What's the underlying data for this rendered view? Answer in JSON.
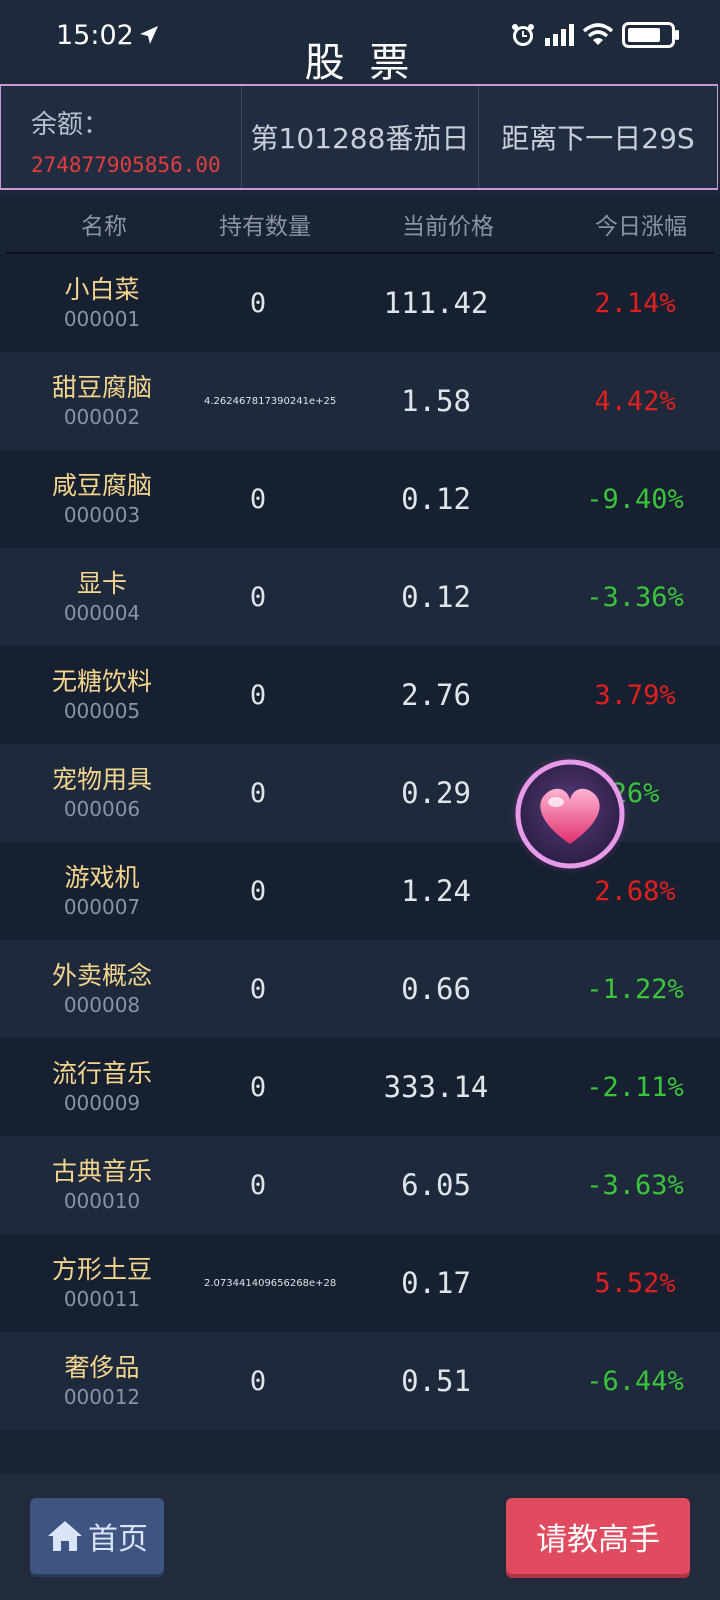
{
  "status_bar": {
    "time": "15:02"
  },
  "header": {
    "title": "股 票"
  },
  "info": {
    "balance_label": "余额：",
    "balance_value": "274877905856.00",
    "day_text": "第101288番茄日",
    "countdown_text": "距离下一日29S"
  },
  "table": {
    "headers": [
      "名称",
      "持有数量",
      "当前价格",
      "今日涨幅"
    ],
    "rows": [
      {
        "name": "小白菜",
        "code": "000001",
        "qty": "0",
        "price": "111.42",
        "change": "2.14%",
        "dir": "up"
      },
      {
        "name": "甜豆腐脑",
        "code": "000002",
        "qty": "4.262467817390241e+25",
        "price": "1.58",
        "change": "4.42%",
        "dir": "up"
      },
      {
        "name": "咸豆腐脑",
        "code": "000003",
        "qty": "0",
        "price": "0.12",
        "change": "-9.40%",
        "dir": "down"
      },
      {
        "name": "显卡",
        "code": "000004",
        "qty": "0",
        "price": "0.12",
        "change": "-3.36%",
        "dir": "down"
      },
      {
        "name": "无糖饮料",
        "code": "000005",
        "qty": "0",
        "price": "2.76",
        "change": "3.79%",
        "dir": "up"
      },
      {
        "name": "宠物用具",
        "code": "000006",
        "qty": "0",
        "price": "0.29",
        "change": "26%",
        "dir": "down"
      },
      {
        "name": "游戏机",
        "code": "000007",
        "qty": "0",
        "price": "1.24",
        "change": "2.68%",
        "dir": "up"
      },
      {
        "name": "外卖概念",
        "code": "000008",
        "qty": "0",
        "price": "0.66",
        "change": "-1.22%",
        "dir": "down"
      },
      {
        "name": "流行音乐",
        "code": "000009",
        "qty": "0",
        "price": "333.14",
        "change": "-2.11%",
        "dir": "down"
      },
      {
        "name": "古典音乐",
        "code": "000010",
        "qty": "0",
        "price": "6.05",
        "change": "-3.63%",
        "dir": "down"
      },
      {
        "name": "方形土豆",
        "code": "000011",
        "qty": "2.073441409656268e+28",
        "price": "0.17",
        "change": "5.52%",
        "dir": "up"
      },
      {
        "name": "奢侈品",
        "code": "000012",
        "qty": "0",
        "price": "0.51",
        "change": "-6.44%",
        "dir": "down"
      }
    ]
  },
  "footer": {
    "home_label": "首页",
    "home_icon": "home-icon",
    "ask_label": "请教高手"
  },
  "overlay": {
    "icon": "heart-icon"
  },
  "colors": {
    "up": "#e01f1f",
    "down": "#3bc43b",
    "name": "#f2d58e",
    "balance": "#e03e3e"
  }
}
